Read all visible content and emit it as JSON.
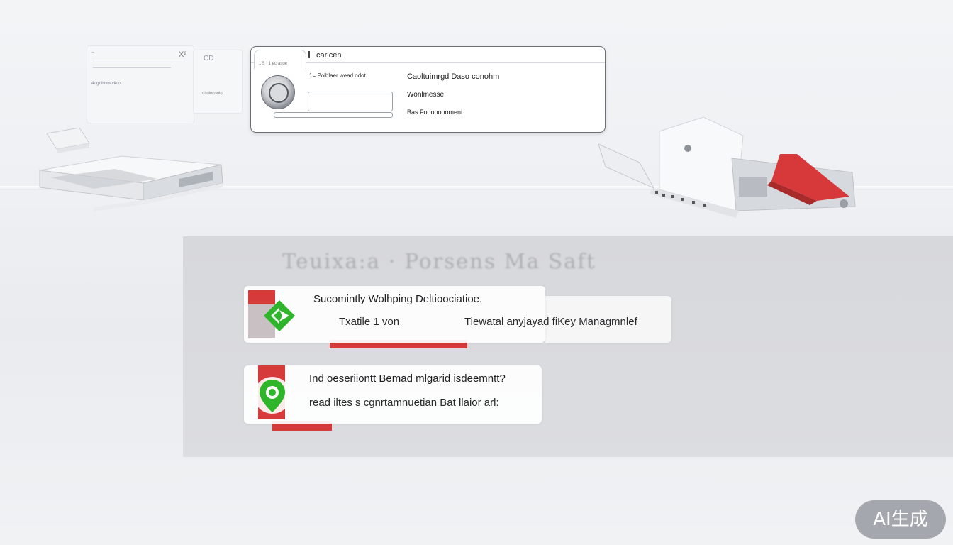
{
  "background_doc": {
    "title": "~",
    "close_glyph": "X²",
    "caption": "4loglobloosorkoo",
    "side_text": "CD",
    "side_caption": "ditolocoolo"
  },
  "dialog": {
    "title": "caricen",
    "tab_text": "1 5 · 1 ecrasoe",
    "field_label": "1= Poiblaer wead odot",
    "info_line_1": "Caoltuimrgd Daso conohm",
    "info_line_2": "Wonlmesse",
    "info_line_3": "Bas Foonooooment."
  },
  "panel": {
    "heading": "Teuixa:a  ·  Porsens  Ma  Saft",
    "cards": [
      {
        "title": "Sucomintly Wolhping Deltioociatioe.",
        "left_text": "Txatile 1 von",
        "right_text": "Tiewatal anyjayad fiKey Managmnlef",
        "badge_icon": "refresh-arrow-icon"
      },
      {
        "title": "Ind oeseriiontt Bemad mlgarid isdeemntt?",
        "left_text": "read iltes s cgnrtamnuetian Bat llaior arl:",
        "badge_icon": "location-pin-icon"
      }
    ]
  },
  "watermark": {
    "label": "AI生成"
  },
  "colors": {
    "accent_red": "#d63a3a",
    "accent_green": "#2fb52a",
    "panel_bg": "#d9dade"
  }
}
